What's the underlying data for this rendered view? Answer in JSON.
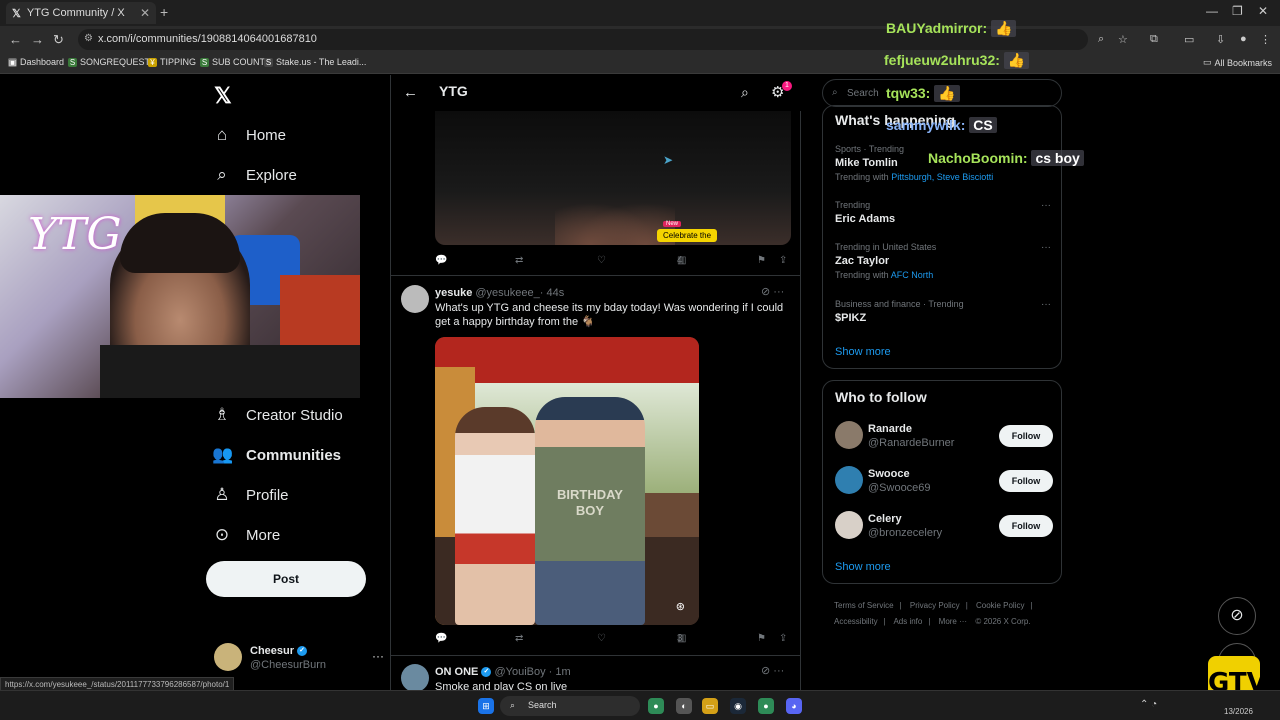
{
  "browser": {
    "tab_title": "YTG Community / X",
    "new_tab_label": "+",
    "url": "x.com/i/communities/1908814064001687810",
    "bookmarks": [
      "Dashboard",
      "SONGREQUESTS",
      "TIPPING",
      "SUB COUNT",
      "Stake.us - The Leadi..."
    ],
    "all_bookmarks_label": "All Bookmarks"
  },
  "left_nav": {
    "items": [
      {
        "label": "Home",
        "icon": "home-icon"
      },
      {
        "label": "Explore",
        "icon": "search-icon"
      },
      {
        "label": "Creator Studio",
        "icon": "flask-icon"
      },
      {
        "label": "Communities",
        "icon": "people-icon"
      },
      {
        "label": "Profile",
        "icon": "person-icon"
      },
      {
        "label": "More",
        "icon": "more-circle-icon"
      }
    ],
    "post_label": "Post",
    "account": {
      "name": "Cheesur",
      "handle": "@CheesurBurn"
    }
  },
  "webcam": {
    "overlay_text": "YTG"
  },
  "community": {
    "title": "YTG",
    "notification_count": "1"
  },
  "feed": {
    "post1": {
      "views": "4",
      "badge_new": "New",
      "badge_text": "Celebrate the"
    },
    "post2": {
      "name": "yesuke",
      "handle": "@yesukeee_",
      "time": "· 44s",
      "text": "What's up YTG and cheese its my bday today! Was wondering if I could get a happy birthday from the 🐐",
      "shirt_text": "BIRTHDAY BOY",
      "views": "3"
    },
    "post3": {
      "name": "ON ONE",
      "handle": "@YouiBoy",
      "time": "· 1m",
      "text": "Smoke and play CS on live"
    }
  },
  "right": {
    "search_placeholder": "Search",
    "whats_happening_title": "What's happening",
    "trends": [
      {
        "meta": "Sports · Trending",
        "title": "Mike Tomlin",
        "with_label": "Trending with",
        "with_links": "Pittsburgh, Steve Bisciotti"
      },
      {
        "meta": "Trending",
        "title": "Eric Adams",
        "with_label": "",
        "with_links": ""
      },
      {
        "meta": "Trending in United States",
        "title": "Zac Taylor",
        "with_label": "Trending with",
        "with_links": "AFC North"
      },
      {
        "meta": "Business and finance · Trending",
        "title": "$PIKZ",
        "with_label": "",
        "with_links": ""
      }
    ],
    "show_more": "Show more",
    "who_to_follow_title": "Who to follow",
    "follow": [
      {
        "name": "Ranarde",
        "handle": "@RanardeBurner",
        "button": "Follow"
      },
      {
        "name": "Swooce",
        "handle": "@Swooce69",
        "button": "Follow"
      },
      {
        "name": "Celery",
        "handle": "@bronzecelery",
        "button": "Follow"
      }
    ],
    "footer": [
      "Terms of Service",
      "|",
      "Privacy Policy",
      "|",
      "Cookie Policy",
      "|",
      "Accessibility",
      "|",
      "Ads info",
      "|",
      "More ···",
      "© 2026 X Corp."
    ]
  },
  "chat": [
    {
      "user": "BAUYadmirror:",
      "msg": "👍"
    },
    {
      "user": "fefjueuw2uhru32:",
      "msg": "👍"
    },
    {
      "user": "tqw33:",
      "msg": "👍"
    },
    {
      "user": "sammywilk:",
      "msg": "CS"
    },
    {
      "user": "NachoBoomin:",
      "msg": "cs boy"
    }
  ],
  "status_bar_url": "https://x.com/yesukeee_/status/2011177733796286587/photo/1",
  "taskbar": {
    "search_label": "Search",
    "date": "13/2026"
  },
  "stream_logo": "GTV"
}
